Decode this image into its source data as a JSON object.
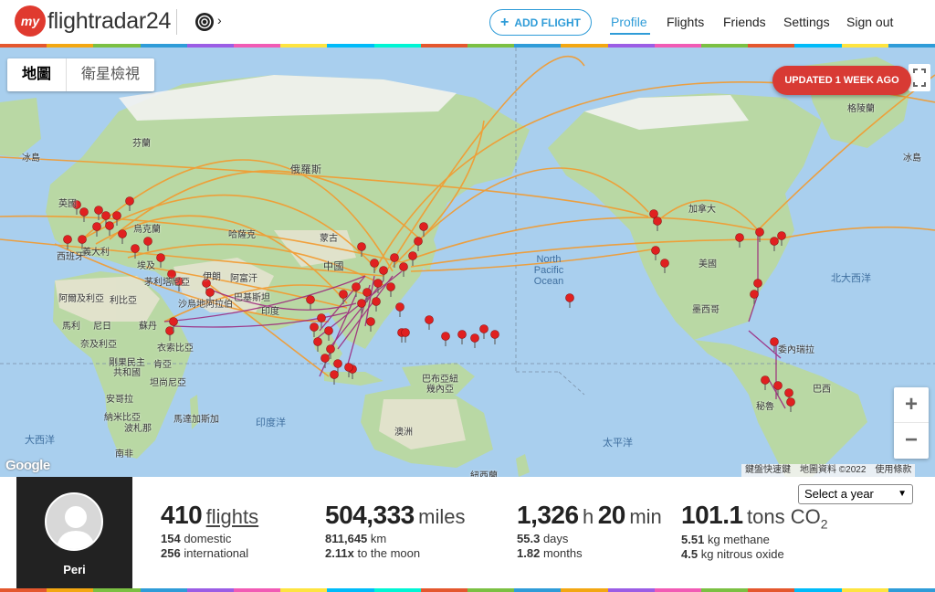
{
  "header": {
    "logo_prefix": "my",
    "logo_text": "flightradar24",
    "radar_chevron": "›",
    "add_flight_label": "ADD FLIGHT",
    "nav": {
      "profile": "Profile",
      "flights": "Flights",
      "friends": "Friends",
      "settings": "Settings",
      "sign_out": "Sign out"
    }
  },
  "map": {
    "toggle": {
      "map": "地圖",
      "satellite": "衛星檢視"
    },
    "updated_badge": "UPDATED 1 WEEK AGO",
    "zoom_in": "+",
    "zoom_out": "−",
    "google": "Google",
    "attribution": {
      "shortcuts": "鍵盤快速鍵",
      "data": "地圖資料 ©2022",
      "terms": "使用條款"
    },
    "ocean_labels": {
      "north_pacific": "North\nPacific\nOcean",
      "indian": "印度洋",
      "atlantic_w": "大西洋",
      "atlantic_e": "北大西洋",
      "pacific_s": "太平洋"
    },
    "place_labels": {
      "iceland_w": "冰島",
      "iceland_e": "冰島",
      "finland": "芬蘭",
      "russia": "俄羅斯",
      "uk": "英國",
      "ukraine": "烏克蘭",
      "france": "義大利",
      "spain": "西班牙",
      "kazakhstan": "哈薩克",
      "mongolia": "蒙古",
      "china": "中國",
      "libya": "利比亞",
      "egypt": "埃及",
      "algeria": "阿爾及利亞",
      "saudi": "沙烏地阿拉伯",
      "iran": "伊朗",
      "afghanistan": "阿富汗",
      "pakistan": "巴基斯坦",
      "india": "印度",
      "mali": "馬利",
      "niger": "尼日",
      "sudan": "蘇丹",
      "nigeria": "奈及利亞",
      "ethiopia": "衣索比亞",
      "drc": "剛果民主共和國",
      "kenya": "肯亞",
      "tanzania": "坦尚尼亞",
      "angola": "安哥拉",
      "namibia": "納米比亞",
      "botswana": "波札那",
      "southafrica": "南非",
      "madagascar": "馬達加斯加",
      "png": "巴布亞紐幾內亞",
      "australia": "澳洲",
      "nz": "紐西蘭",
      "canada": "加拿大",
      "usa": "美國",
      "mexico": "墨西哥",
      "venezuela": "委內瑞拉",
      "brazil": "巴西",
      "peru": "秘魯",
      "greenland": "格陵蘭",
      "mauritania": "茅利塔尼亞"
    }
  },
  "stats": {
    "user_name": "Peri",
    "flights": {
      "value": "410",
      "unit": "flights",
      "domestic_n": "154",
      "domestic": "domestic",
      "intl_n": "256",
      "intl": "international"
    },
    "distance": {
      "value": "504,333",
      "unit": "miles",
      "km_n": "811,645",
      "km": "km",
      "moon_n": "2.11x",
      "moon": "to the moon"
    },
    "time": {
      "hours": "1,326",
      "h": "h",
      "minutes": "20",
      "min": "min",
      "days_n": "55.3",
      "days": "days",
      "months_n": "1.82",
      "months": "months"
    },
    "co2": {
      "value": "101.1",
      "unit": "tons CO",
      "sub2": "2",
      "methane_n": "5.51",
      "methane": "kg methane",
      "n2o_n": "4.5",
      "n2o": "kg nitrous oxide"
    },
    "year_select": "Select a year"
  },
  "colors": {
    "accent": "#2f9cd8",
    "badge": "#d83a34",
    "route_orange": "#f39a2e",
    "route_purple": "#9b1f7a",
    "pin": "#e02020"
  }
}
